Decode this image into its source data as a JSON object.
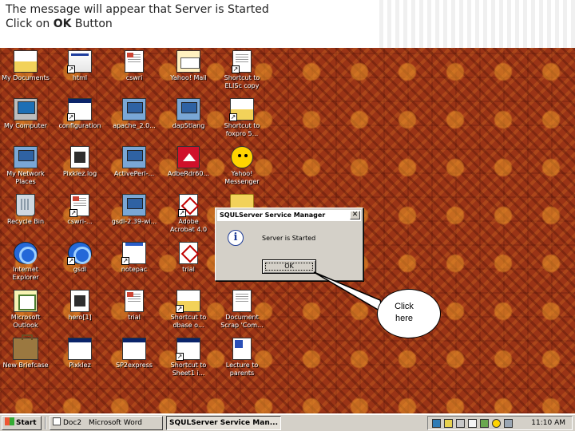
{
  "slide": {
    "line1": "The message will appear that Server is Started",
    "line2_prefix": "Click on",
    "line2_bold": "OK",
    "line2_suffix": "Button"
  },
  "desktop": {
    "icons": [
      {
        "label": "My Documents",
        "icon": "my-documents-icon"
      },
      {
        "label": "html",
        "icon": "webpage-shortcut-icon"
      },
      {
        "label": "cswri",
        "icon": "document-icon"
      },
      {
        "label": "Yahoo! Mail",
        "icon": "yahoo-mail-icon"
      },
      {
        "label": "Shortcut to\nELISc copy",
        "icon": "shortcut-icon"
      },
      {
        "label": "My Computer",
        "icon": "my-computer-icon"
      },
      {
        "label": "configuration",
        "icon": "window-shortcut-icon"
      },
      {
        "label": "apache_2.0...",
        "icon": "network-computer-icon"
      },
      {
        "label": "dap5tlang",
        "icon": "network-computer-icon"
      },
      {
        "label": "Shortcut to\nfoxpro 5...",
        "icon": "folder-shortcut-icon"
      },
      {
        "label": "My Network\nPlaces",
        "icon": "network-places-icon"
      },
      {
        "label": "Pixklez.log",
        "icon": "log-file-icon"
      },
      {
        "label": "ActivePerl-...",
        "icon": "installer-icon"
      },
      {
        "label": "AdbeRdr60...",
        "icon": "adobe-reader-installer-icon"
      },
      {
        "label": "Yahoo!\nMessenger",
        "icon": "yahoo-messenger-icon"
      },
      {
        "label": "Recycle Bin",
        "icon": "recycle-bin-icon"
      },
      {
        "label": "cswri-...",
        "icon": "document-shortcut-icon"
      },
      {
        "label": "gsdl-2.39-wi...",
        "icon": "installer-icon"
      },
      {
        "label": "Adobe\nAcrobat 4.0",
        "icon": "acrobat-icon"
      },
      {
        "label": "",
        "icon": "folder-icon"
      },
      {
        "label": "Internet\nExplorer",
        "icon": "internet-explorer-icon"
      },
      {
        "label": "gsdl",
        "icon": "shortcut-icon"
      },
      {
        "label": "notepac",
        "icon": "notepad-icon"
      },
      {
        "label": "trial",
        "icon": "pdf-icon"
      },
      {
        "label": "Microsoft\nOutlook",
        "icon": "outlook-icon"
      },
      {
        "label": "hero[1]",
        "icon": "log-file-icon"
      },
      {
        "label": "trial",
        "icon": "document-icon"
      },
      {
        "label": "Shortcut to\ndbase o...",
        "icon": "shortcut-icon"
      },
      {
        "label": "Document\nScrap 'Com...",
        "icon": "document-scrap-icon"
      },
      {
        "label": "New Briefcase",
        "icon": "briefcase-icon"
      },
      {
        "label": "Pixklez",
        "icon": "window-icon"
      },
      {
        "label": "SP2express",
        "icon": "window-icon"
      },
      {
        "label": "Shortcut to\nSheet1 i...",
        "icon": "shortcut-icon"
      },
      {
        "label": "Lecture to\nparents",
        "icon": "word-document-icon"
      }
    ]
  },
  "dialog": {
    "title": "SQULServer Service Manager",
    "close_glyph": "✕",
    "info_glyph": "i",
    "message": "Server is Started",
    "ok_label": "OK"
  },
  "callout": {
    "text": "Click here"
  },
  "taskbar": {
    "start_label": "Start",
    "items": [
      {
        "label": "Doc2"
      },
      {
        "label": "Microsoft Word"
      },
      {
        "label": "SQULServer Service Man..."
      }
    ],
    "clock": "11:10 AM"
  }
}
